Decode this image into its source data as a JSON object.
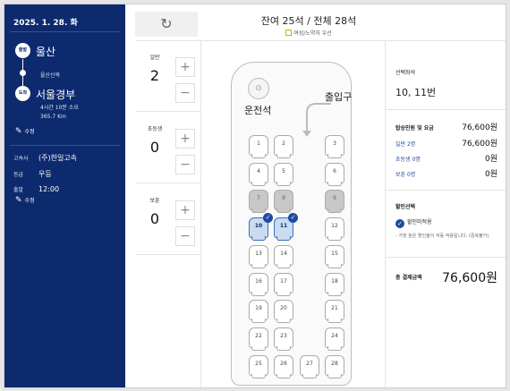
{
  "trip": {
    "date": "2025. 1. 28. 화",
    "depart_badge": "출발",
    "depart_city": "울산",
    "via": "울산신복",
    "arrive_badge": "도착",
    "arrive_city": "서울경부",
    "duration": "4시간 10분 소요",
    "distance": "365.7 Km",
    "edit_label": "수정",
    "company_key": "고속사",
    "company_val": "(주)한일고속",
    "grade_key": "등급",
    "grade_val": "우등",
    "time_key": "출발",
    "time_val": "12:00",
    "edit2_label": "수정"
  },
  "header": {
    "title": "잔여 25석 / 전체 28석",
    "note": "여성/노약자 우선"
  },
  "counts": [
    {
      "label": "일반",
      "value": "2"
    },
    {
      "label": "초등생",
      "value": "0"
    },
    {
      "label": "보훈",
      "value": "0"
    }
  ],
  "buttons": {
    "plus": "+",
    "minus": "−",
    "refresh": "↻"
  },
  "bus": {
    "driver_label": "운전석",
    "door_label": "출입구",
    "seats": [
      {
        "n": "1",
        "state": "open"
      },
      {
        "n": "2",
        "state": "open"
      },
      {
        "n": "3",
        "state": "open"
      },
      {
        "n": "4",
        "state": "open"
      },
      {
        "n": "5",
        "state": "open"
      },
      {
        "n": "6",
        "state": "open"
      },
      {
        "n": "7",
        "state": "sold"
      },
      {
        "n": "8",
        "state": "sold"
      },
      {
        "n": "9",
        "state": "sold"
      },
      {
        "n": "10",
        "state": "selected"
      },
      {
        "n": "11",
        "state": "selected"
      },
      {
        "n": "12",
        "state": "open"
      },
      {
        "n": "13",
        "state": "open"
      },
      {
        "n": "14",
        "state": "open"
      },
      {
        "n": "15",
        "state": "open"
      },
      {
        "n": "16",
        "state": "open"
      },
      {
        "n": "17",
        "state": "open"
      },
      {
        "n": "18",
        "state": "open"
      },
      {
        "n": "19",
        "state": "open"
      },
      {
        "n": "20",
        "state": "open"
      },
      {
        "n": "21",
        "state": "open"
      },
      {
        "n": "22",
        "state": "open"
      },
      {
        "n": "23",
        "state": "open"
      },
      {
        "n": "24",
        "state": "open"
      },
      {
        "n": "25",
        "state": "open"
      },
      {
        "n": "26",
        "state": "open"
      },
      {
        "n": "27",
        "state": "open"
      },
      {
        "n": "28",
        "state": "open"
      }
    ]
  },
  "summary": {
    "selected_label": "선택좌석",
    "selected_value": "10, 11번",
    "total_label": "탑승인원 및 요금",
    "total_value": "76,600원",
    "rows": [
      {
        "label": "일반 2명",
        "value": "76,600원"
      },
      {
        "label": "초등생 0명",
        "value": "0원"
      },
      {
        "label": "보훈 0명",
        "value": "0원"
      }
    ],
    "discount_title": "할인선택",
    "discount_option": "할인미적용",
    "discount_note": "- 가장 높은 할인율이 자동 적용됩니다. (중복불가)",
    "pay_label": "총 결제금액",
    "pay_value": "76,600원"
  },
  "colors": {
    "primary": "#0d2a6e",
    "selected": "#1f4aa0",
    "sold": "#c8c8c8"
  }
}
